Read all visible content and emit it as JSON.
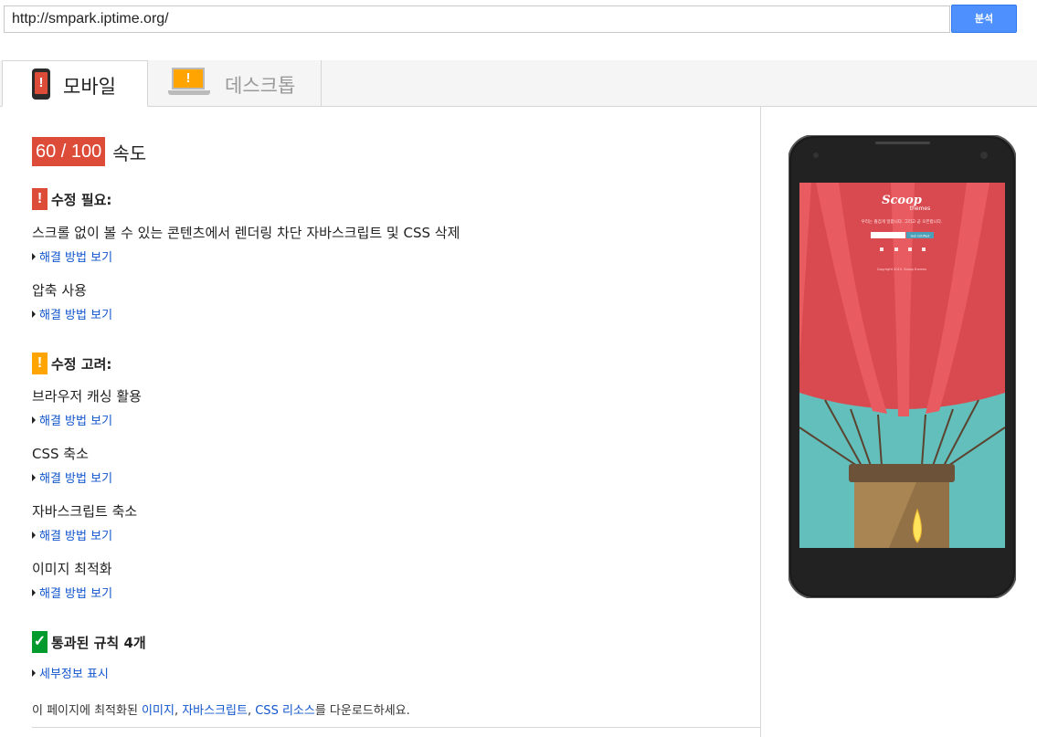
{
  "url_bar": {
    "value": "http://smpark.iptime.org/",
    "analyze_label": "분석"
  },
  "tabs": [
    {
      "label": "모바일",
      "icon": "mobile-phone-icon",
      "active": true
    },
    {
      "label": "데스크톱",
      "icon": "laptop-icon",
      "active": false
    }
  ],
  "score": {
    "value": "60 / 100",
    "label": "속도"
  },
  "sections": {
    "should_fix": {
      "title": "수정 필요:",
      "badge": "!",
      "color": "#dd4b39",
      "rules": [
        {
          "name": "스크롤 없이 볼 수 있는 콘텐츠에서 렌더링 차단 자바스크립트 및 CSS 삭제",
          "link": "해결 방법 보기"
        },
        {
          "name": "압축 사용",
          "link": "해결 방법 보기"
        }
      ]
    },
    "consider_fixing": {
      "title": "수정 고려:",
      "badge": "!",
      "color": "#ffa400",
      "rules": [
        {
          "name": "브라우저 캐싱 활용",
          "link": "해결 방법 보기"
        },
        {
          "name": "CSS 축소",
          "link": "해결 방법 보기"
        },
        {
          "name": "자바스크립트 축소",
          "link": "해결 방법 보기"
        },
        {
          "name": "이미지 최적화",
          "link": "해결 방법 보기"
        }
      ]
    },
    "passed": {
      "title": "통과된 규칙 4개",
      "badge": "✓",
      "color": "#009a2d",
      "link": "세부정보 표시"
    }
  },
  "footer": {
    "prefix": "이 페이지에 최적화된 ",
    "link_images": "이미지",
    "sep1": ", ",
    "link_js": "자바스크립트",
    "sep2": ", ",
    "link_css": "CSS 리소스",
    "suffix": "를 다운로드하세요."
  },
  "preview": {
    "logo": "Scoop",
    "logo_sub": "themes",
    "tagline": "우리는 즐겁게 일합니다. 그리고 곧 오픈합니다.",
    "button": "Get notified",
    "copyright": "Copyright 2015. Scoop themes"
  }
}
